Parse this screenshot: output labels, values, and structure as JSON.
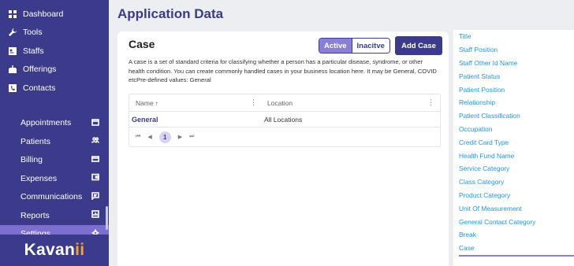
{
  "sidebar": {
    "top_items": [
      {
        "label": "Dashboard",
        "icon": "dashboard-icon"
      },
      {
        "label": "Tools",
        "icon": "wrench-icon"
      },
      {
        "label": "Staffs",
        "icon": "staff-card-icon"
      },
      {
        "label": "Offerings",
        "icon": "offerings-icon"
      },
      {
        "label": "Contacts",
        "icon": "contacts-icon"
      }
    ],
    "sub_items": [
      {
        "label": "Appointments",
        "icon": "calendar-icon"
      },
      {
        "label": "Patients",
        "icon": "people-icon"
      },
      {
        "label": "Billing",
        "icon": "card-icon"
      },
      {
        "label": "Expenses",
        "icon": "wallet-icon"
      },
      {
        "label": "Communications",
        "icon": "chat-icon"
      },
      {
        "label": "Reports",
        "icon": "report-icon"
      },
      {
        "label": "Settings",
        "icon": "gear-icon",
        "active": true
      }
    ],
    "logo": {
      "main": "Kavan",
      "accent": "ii"
    }
  },
  "page": {
    "title": "Application Data"
  },
  "card": {
    "title": "Case",
    "toggle": {
      "active": "Active",
      "inactive": "Inacitve"
    },
    "add_button": "Add Case",
    "description": "A case is a set of standard criteria for classifying whether a person has a particular disease, syndrome, or other health condition. You can create commonly handled cases in your business location here. It may be General, COVID etcPre-defined values: General"
  },
  "table": {
    "columns": {
      "name": "Name",
      "location": "Location"
    },
    "sort_indicator": "↑",
    "rows": [
      {
        "name": "General",
        "location": "All Locations"
      }
    ],
    "pager": {
      "first": "⏮",
      "prev": "◀",
      "page": "1",
      "next": "▶",
      "last": "⏭"
    }
  },
  "right_list": [
    "Title",
    "Staff Position",
    "Staff Other Id Name",
    "Patient Status",
    "Patient Position",
    "Relationship",
    "Patient Classification",
    "Occupation",
    "Credit Card Type",
    "Health Fund Name",
    "Service Category",
    "Class Category",
    "Product Category",
    "Unit Of Measurement",
    "General Contact Category",
    "Break",
    "Case"
  ],
  "colors": {
    "brand": "#3c3a8a",
    "accent": "#8a7fd6",
    "link": "#2196e8"
  }
}
